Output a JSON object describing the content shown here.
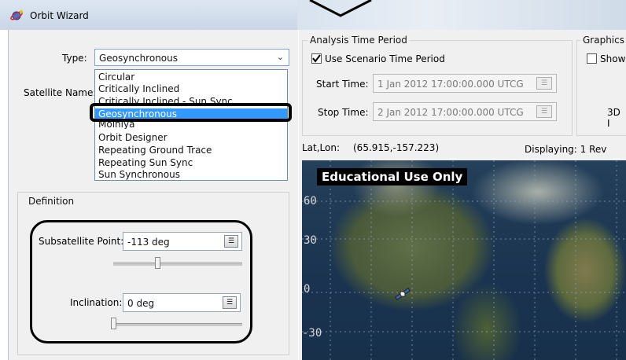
{
  "window": {
    "title": "Orbit Wizard"
  },
  "form": {
    "type_label": "Type:",
    "type_value": "Geosynchronous",
    "satellite_name_label": "Satellite Name:",
    "type_options": [
      "Circular",
      "Critically Inclined",
      "Critically Inclined - Sun Sync",
      "Geosynchronous",
      "Molniya",
      "Orbit Designer",
      "Repeating Ground Trace",
      "Repeating Sun Sync",
      "Sun Synchronous"
    ],
    "selected_index": 3
  },
  "definition": {
    "legend": "Definition",
    "subsatellite_label": "Subsatellite Point:",
    "subsatellite_value": "-113 deg",
    "inclination_label": "Inclination:",
    "inclination_value": "0 deg"
  },
  "analysis": {
    "legend": "Analysis Time Period",
    "use_scenario_label": "Use Scenario Time Period",
    "use_scenario_checked": true,
    "start_label": "Start Time:",
    "start_value": "1 Jan 2012 17:00:00.000 UTCG",
    "stop_label": "Stop Time:",
    "stop_value": "2 Jan 2012 17:00:00.000 UTCG"
  },
  "graphics": {
    "legend": "Graphics",
    "show_label": "Show",
    "label_3d": "3D I"
  },
  "map": {
    "latlon_label": "Lat,Lon:",
    "latlon_value": "(65.915,-157.223)",
    "displaying": "Displaying: 1 Rev",
    "badge": "Educational Use Only",
    "lat_labels": [
      "60",
      "30",
      "0",
      "-30"
    ]
  },
  "colors": {
    "selection": "#3399ff",
    "title_bar": "#c9d6e6"
  }
}
